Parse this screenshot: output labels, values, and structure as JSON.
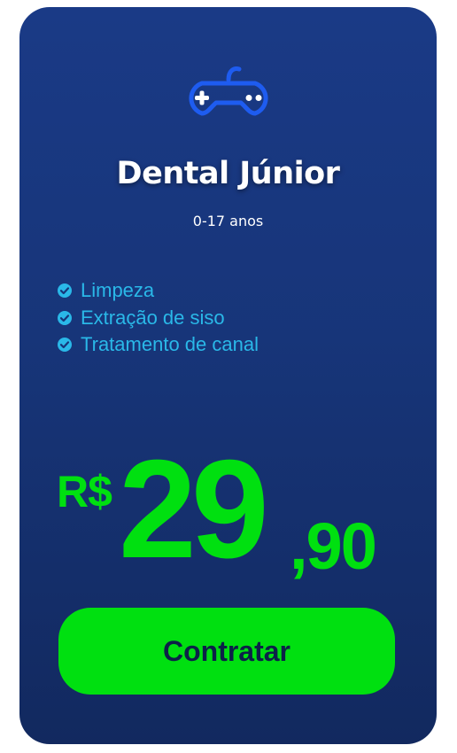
{
  "plan": {
    "icon": "gamepad-icon",
    "title": "Dental Júnior",
    "age_range": "0-17 anos",
    "features": [
      {
        "label": "Limpeza",
        "icon": "check-circle-icon"
      },
      {
        "label": "Extração de siso",
        "icon": "check-circle-icon"
      },
      {
        "label": "Tratamento de canal",
        "icon": "check-circle-icon"
      }
    ],
    "price": {
      "currency": "R$",
      "integer": "29",
      "decimal": ",90"
    },
    "cta_label": "Contratar"
  },
  "colors": {
    "card_background": "#173579",
    "accent_green": "#00e010",
    "feature_text": "#2ab8e8",
    "icon_blue": "#1e5cf0",
    "button_text": "#0c2148"
  }
}
